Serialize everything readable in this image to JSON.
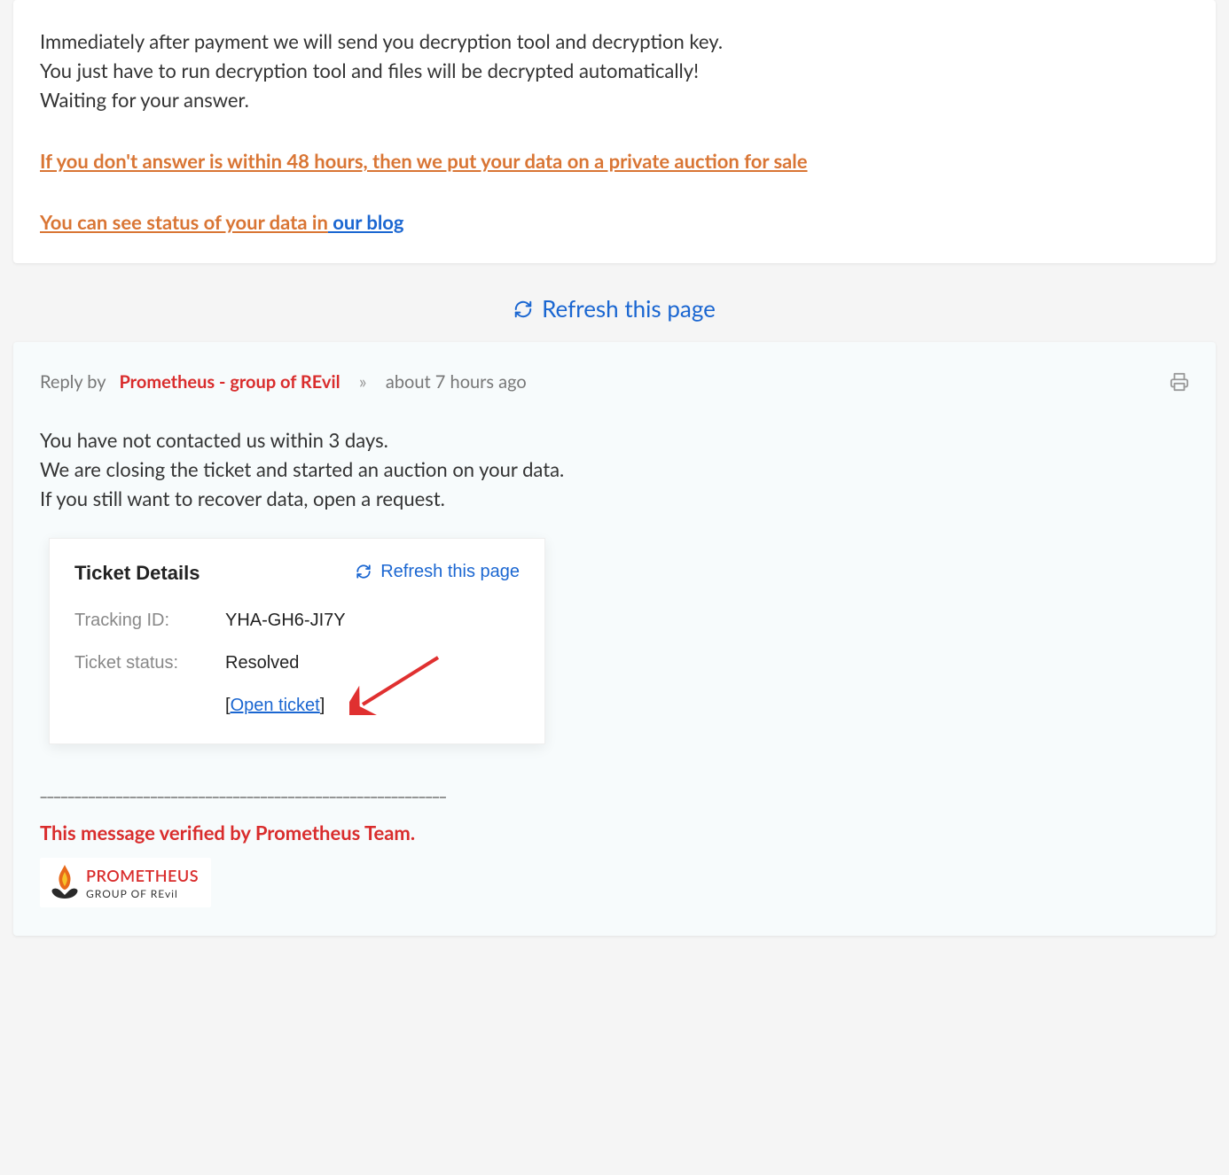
{
  "message1": {
    "line1": "Immediately after payment we will send you decryption tool and decryption key.",
    "line2": "You just have to run decryption tool and files will be decrypted automatically!",
    "line3": "Waiting for your answer.",
    "warn": "If you don't answer is within 48 hours, then we put your data on a private auction for sale",
    "blog_prefix": "You can see status of your data in",
    "blog_link": " our blog"
  },
  "refresh": {
    "label": "Refresh this page"
  },
  "reply": {
    "prefix": "Reply by",
    "author": "Prometheus - group of REvil",
    "sep": "»",
    "time": "about 7 hours ago",
    "body1": "You have not contacted us within 3 days.",
    "body2": "We are closing the ticket and started an auction on your data.",
    "body3": "If you still want to recover data, open a request."
  },
  "ticket": {
    "title": "Ticket Details",
    "refresh": "Refresh this page",
    "tracking_label": "Tracking ID:",
    "tracking_value": "YHA-GH6-JI7Y",
    "status_label": "Ticket status:",
    "status_value": "Resolved",
    "open_prefix": "[",
    "open_link": "Open ticket",
    "open_suffix": "]"
  },
  "footer": {
    "divider": "___________________________________________________________",
    "verified": "This message verified by Prometheus Team.",
    "brand": "PROMETHEUS",
    "sub": "GROUP OF REvil"
  }
}
